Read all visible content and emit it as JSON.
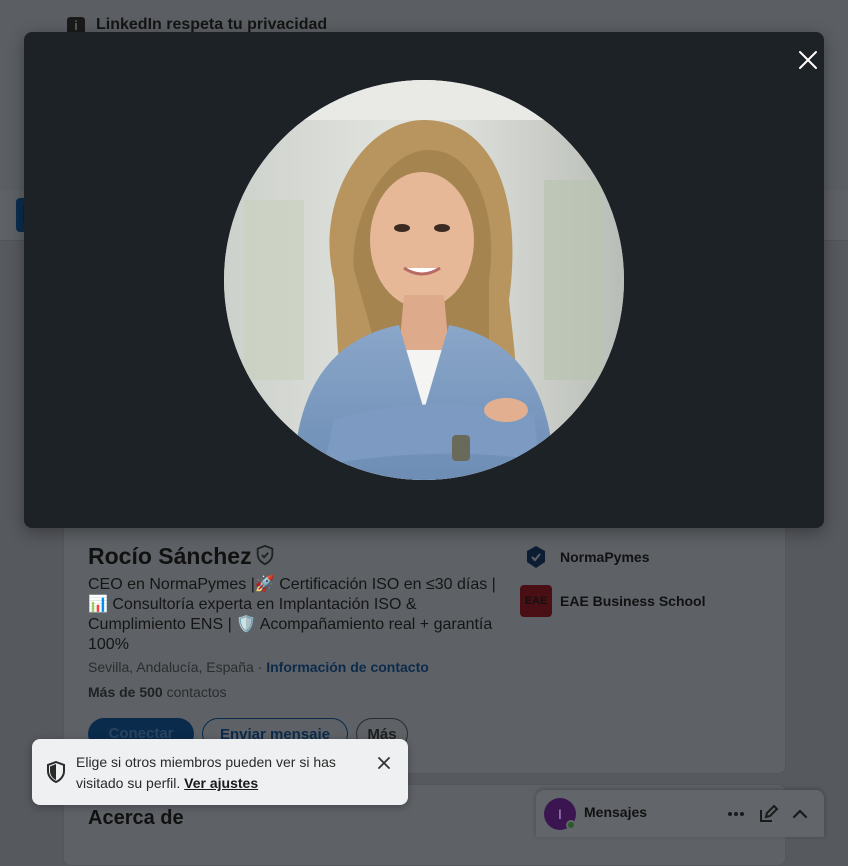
{
  "privacy_banner": {
    "title": "LinkedIn respeta tu privacidad"
  },
  "profile": {
    "name": "Rocío Sánchez",
    "headline": "CEO en NormaPymes |🚀 Certificación ISO en ≤30 días | 📊 Consultoría experta en Implantación ISO & Cumplimiento ENS | 🛡️ Acompañamiento real + garantía 100%",
    "location": "Sevilla, Andalucía, España",
    "separator": " · ",
    "contact_link": "Información de contacto",
    "connections_count": "Más de 500",
    "connections_label": " contactos",
    "buttons": {
      "connect": "Conectar",
      "message": "Enviar mensaje",
      "more": "Más"
    },
    "companies": [
      {
        "name": "NormaPymes"
      },
      {
        "name": "EAE Business School",
        "logo_text": "EAE"
      }
    ],
    "about_title": "Acerca de"
  },
  "toast": {
    "text": "Elige si otros miembros pueden ver si has visitado su perfil.",
    "link": "Ver ajustes"
  },
  "messaging": {
    "label": "Mensajes",
    "avatar_letter": "I"
  },
  "colors": {
    "modal_bg": "#1d2226",
    "overlay": "#56595e",
    "accent": "#0a66c2"
  }
}
